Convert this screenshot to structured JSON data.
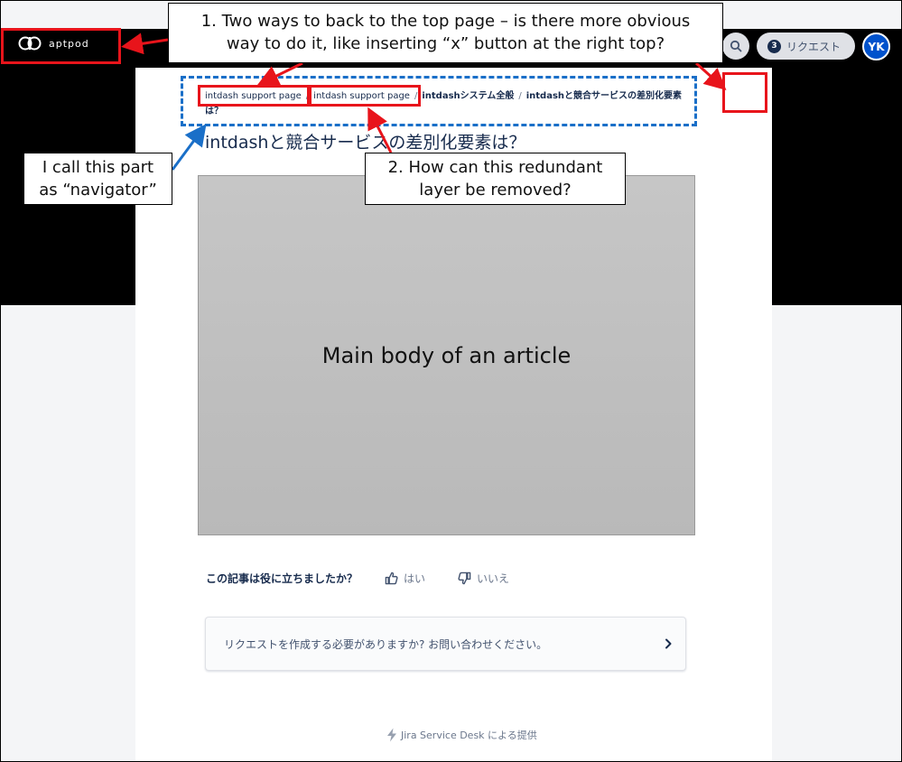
{
  "header": {
    "logo_text": "aptpod",
    "request_count": "3",
    "request_label": "リクエスト",
    "avatar_initials": "YK"
  },
  "breadcrumb": {
    "items": [
      "intdash support page",
      "intdash support page",
      "intdashシステム全般",
      "intdashと競合サービスの差別化要素は？"
    ],
    "separator": "/"
  },
  "article": {
    "title": "intdashと競合サービスの差別化要素は？",
    "body_placeholder": "Main body of an article"
  },
  "feedback": {
    "question": "この記事は役に立ちましたか？",
    "yes": "はい",
    "no": "いいえ"
  },
  "request_prompt": "リクエストを作成する必要がありますか? お問い合わせください。",
  "powered_by": "Jira Service Desk による提供",
  "annotations": {
    "callout_1_line1": "1. Two ways to back to the top page – is there more obvious",
    "callout_1_line2": "way to do it, like inserting “x” button at the right top?",
    "callout_2_line1": "2. How can this redundant",
    "callout_2_line2": "layer be removed?",
    "callout_3_line1": "I call this part",
    "callout_3_line2": "as “navigator”"
  },
  "colors": {
    "header_bg": "#000000",
    "annotation_red": "#e8141b",
    "annotation_blue": "#1a6fc8",
    "avatar_bg": "#0052cc"
  },
  "icons": [
    "aptpod-logo-icon",
    "search-icon",
    "thumbs-up-icon",
    "thumbs-down-icon",
    "chevron-right-icon",
    "lightning-icon"
  ]
}
